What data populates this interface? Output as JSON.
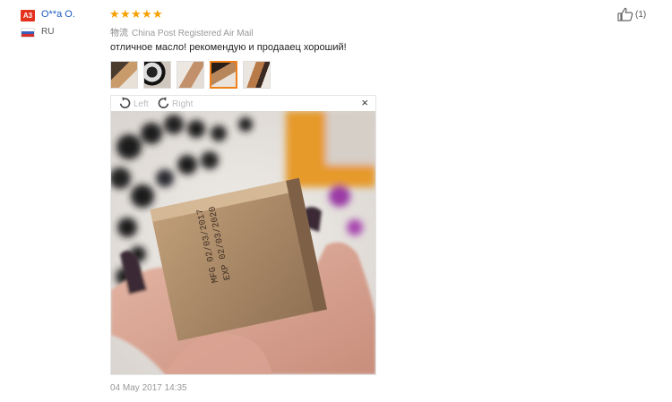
{
  "reviewer": {
    "badge": "A3",
    "name": "O**a O.",
    "country": "RU"
  },
  "review": {
    "rating": 5,
    "stars": [
      "★",
      "★",
      "★",
      "★",
      "★"
    ],
    "shipping_label": "物流",
    "shipping_method": "China Post Registered Air Mail",
    "text": "отличное масло! рекомендую и продааец хороший!",
    "date": "04 May 2017 14:35",
    "helpful_count": "(1)",
    "thumbnails": [
      {
        "name": "photo-1",
        "active": false
      },
      {
        "name": "photo-2",
        "active": false
      },
      {
        "name": "photo-3",
        "active": false
      },
      {
        "name": "photo-4",
        "active": true
      },
      {
        "name": "photo-5",
        "active": false
      }
    ]
  },
  "viewer": {
    "rotate_left_label": "Left",
    "rotate_right_label": "Right",
    "close_symbol": "×",
    "photo_print_line1": "MFG 02/03/2017",
    "photo_print_line2": "EXP 02/03/2020"
  },
  "colors": {
    "accent_orange": "#f0801a",
    "star": "#f6a000",
    "badge_red": "#e3311d",
    "name_blue": "#1e5bbf"
  },
  "icons": {
    "thumbs_up": "thumbs-up-icon",
    "rotate_left": "rotate-left-icon",
    "rotate_right": "rotate-right-icon",
    "close": "close-icon",
    "flag": "russia-flag-icon"
  }
}
